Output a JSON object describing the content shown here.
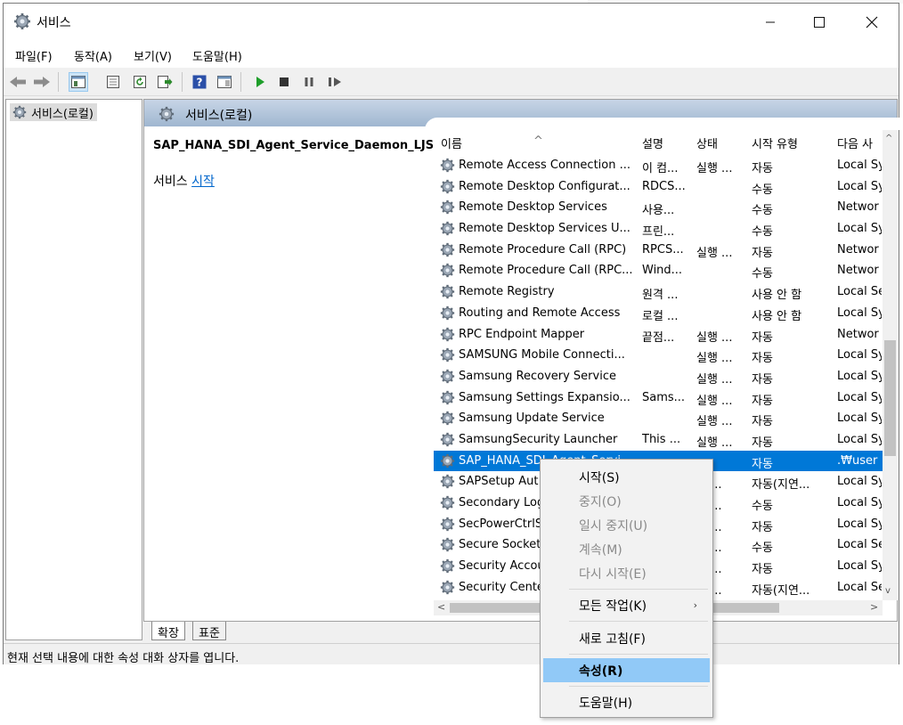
{
  "window": {
    "title": "서비스"
  },
  "menu": [
    "파일(F)",
    "동작(A)",
    "보기(V)",
    "도움말(H)"
  ],
  "tree": {
    "root": "서비스(로컬)"
  },
  "main": {
    "header": "서비스(로컬)",
    "selected_service": "SAP_HANA_SDI_Agent_Service_Daemon_LJS",
    "action_prefix": "서비스",
    "action_link": "시작"
  },
  "columns": {
    "name": "이름",
    "desc": "설명",
    "status": "상태",
    "startup": "시작 유형",
    "logon": "다음 사"
  },
  "services": [
    {
      "name": "Remote Access Connection ...",
      "desc": "이 컴...",
      "status": "실행 ...",
      "startup": "자동",
      "logon": "Local Sy"
    },
    {
      "name": "Remote Desktop Configurat...",
      "desc": "RDCS...",
      "status": "",
      "startup": "수동",
      "logon": "Local Sy"
    },
    {
      "name": "Remote Desktop Services",
      "desc": "사용...",
      "status": "",
      "startup": "수동",
      "logon": "Networ"
    },
    {
      "name": "Remote Desktop Services U...",
      "desc": "프린...",
      "status": "",
      "startup": "수동",
      "logon": "Local Sy"
    },
    {
      "name": "Remote Procedure Call (RPC)",
      "desc": "RPCS...",
      "status": "실행 ...",
      "startup": "자동",
      "logon": "Networ"
    },
    {
      "name": "Remote Procedure Call (RPC...",
      "desc": "Wind...",
      "status": "",
      "startup": "수동",
      "logon": "Networ"
    },
    {
      "name": "Remote Registry",
      "desc": "원격 ...",
      "status": "",
      "startup": "사용 안 함",
      "logon": "Local Se"
    },
    {
      "name": "Routing and Remote Access",
      "desc": "로컬 ...",
      "status": "",
      "startup": "사용 안 함",
      "logon": "Local Sy"
    },
    {
      "name": "RPC Endpoint Mapper",
      "desc": "끝점...",
      "status": "실행 ...",
      "startup": "자동",
      "logon": "Networ"
    },
    {
      "name": "SAMSUNG Mobile Connecti...",
      "desc": "",
      "status": "실행 ...",
      "startup": "자동",
      "logon": "Local Sy"
    },
    {
      "name": "Samsung Recovery Service",
      "desc": "",
      "status": "실행 ...",
      "startup": "자동",
      "logon": "Local Sy"
    },
    {
      "name": "Samsung Settings Expansio...",
      "desc": "Sams...",
      "status": "실행 ...",
      "startup": "자동",
      "logon": "Local Sy"
    },
    {
      "name": "Samsung Update Service",
      "desc": "",
      "status": "실행 ...",
      "startup": "자동",
      "logon": "Local Sy"
    },
    {
      "name": "SamsungSecurity Launcher",
      "desc": "This ...",
      "status": "실행 ...",
      "startup": "자동",
      "logon": "Local Sy"
    },
    {
      "name": "SAP_HANA_SDI_Agent_Servi...",
      "desc": "",
      "status": "",
      "startup": "자동",
      "logon": ".₩user"
    },
    {
      "name": "SAPSetup Aut",
      "desc": "",
      "status": "행 ...",
      "startup": "자동(지연...",
      "logon": "Local Sy"
    },
    {
      "name": "Secondary Log",
      "desc": "",
      "status": "행 ...",
      "startup": "수동",
      "logon": "Local Sy"
    },
    {
      "name": "SecPowerCtrlS",
      "desc": "",
      "status": "행 ...",
      "startup": "자동",
      "logon": "Local Sy"
    },
    {
      "name": "Secure Socket",
      "desc": "",
      "status": "행 ...",
      "startup": "수동",
      "logon": "Local Se"
    },
    {
      "name": "Security Accou",
      "desc": "",
      "status": "행 ...",
      "startup": "자동",
      "logon": "Local Sy"
    },
    {
      "name": "Security Cente",
      "desc": "",
      "status": "행 ...",
      "startup": "자동(지연...",
      "logon": "Local Se"
    }
  ],
  "selected_index": 14,
  "tabs": {
    "extended": "확장",
    "standard": "표준"
  },
  "status_bar": "현재 선택 내용에 대한 속성 대화 상자를 엽니다.",
  "context_menu": {
    "start": "시작(S)",
    "stop": "중지(O)",
    "pause": "일시 중지(U)",
    "resume": "계속(M)",
    "restart": "다시 시작(E)",
    "all_tasks": "모든 작업(K)",
    "refresh": "새로 고침(F)",
    "properties": "속성(R)",
    "help": "도움말(H)"
  },
  "colors": {
    "selection": "#0078d7",
    "menu_highlight": "#91c9f7",
    "header_blue": "#9fb6d0",
    "link": "#0066cc"
  },
  "icons": [
    "services-gear-icon",
    "back-arrow-icon",
    "forward-arrow-icon",
    "play-icon",
    "stop-icon",
    "pause-icon",
    "resume-icon",
    "help-icon",
    "refresh-icon",
    "export-icon"
  ]
}
